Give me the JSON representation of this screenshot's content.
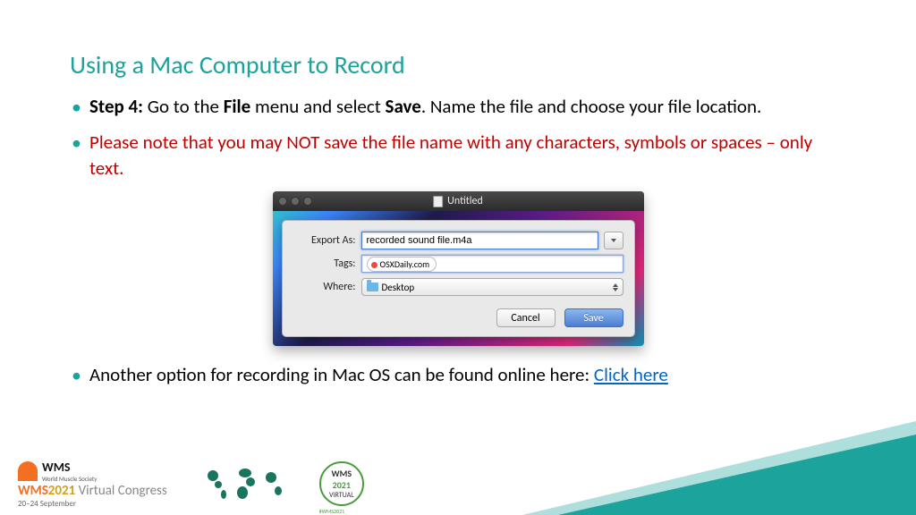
{
  "title": "Using a Mac Computer to Record",
  "bullets": {
    "step_label": "Step 4:",
    "step_text_1": " Go to the ",
    "step_bold_file": "File",
    "step_text_2": " menu and select ",
    "step_bold_save": "Save",
    "step_text_3": ". Name the file and choose your file location.",
    "note_text": "Please note that you may NOT save the file name with any characters, symbols or spaces – only text.",
    "another_text": "Another option for recording in Mac OS can be found online here: ",
    "link_text": "Click here"
  },
  "dialog": {
    "window_title": "Untitled",
    "export_label": "Export As:",
    "export_value": "recorded sound file.m4a",
    "tags_label": "Tags:",
    "tags_value": "OSXDaily.com",
    "where_label": "Where:",
    "where_value": "Desktop",
    "cancel_label": "Cancel",
    "save_label": "Save"
  },
  "footer": {
    "wms_text": "WMS",
    "wms_sub": "World Muscle Society",
    "brand_orange": "WMS",
    "brand_yellow": "2021",
    "brand_gray": " Virtual Congress",
    "dates": "20–24 September",
    "badge_wms": "WMS",
    "badge_year": "2021",
    "badge_virtual": "VIRTUAL",
    "badge_hash": "#WMS2021"
  }
}
